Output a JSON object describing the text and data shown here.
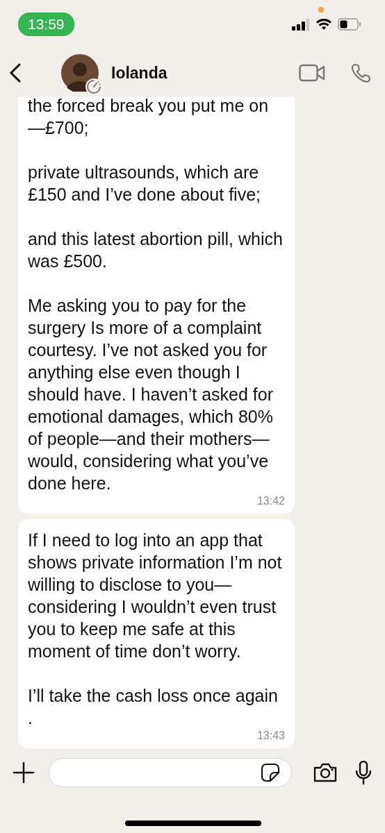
{
  "status_bar": {
    "time": "13:59"
  },
  "header": {
    "contact_name": "Iolanda"
  },
  "messages": [
    {
      "paragraphs": [
        "the forced break you put me on —£700;",
        "private ultrasounds, which are £150 and I’ve done about five;",
        "and this latest abortion pill, which was £500.",
        "Me asking you to pay for the surgery Is more of a complaint courtesy. I’ve not asked you for anything else even though I should have. I haven’t asked for emotional damages, which 80% of people—and their mothers—would, considering what you’ve done here."
      ],
      "time": "13:42"
    },
    {
      "paragraphs": [
        "If I need to log into an app that shows private information I’m not willing to disclose to you—considering I wouldn’t even trust you to keep me safe at this moment of time don’t worry.",
        "I’ll take the cash loss once again ."
      ],
      "time": "13:43"
    }
  ]
}
